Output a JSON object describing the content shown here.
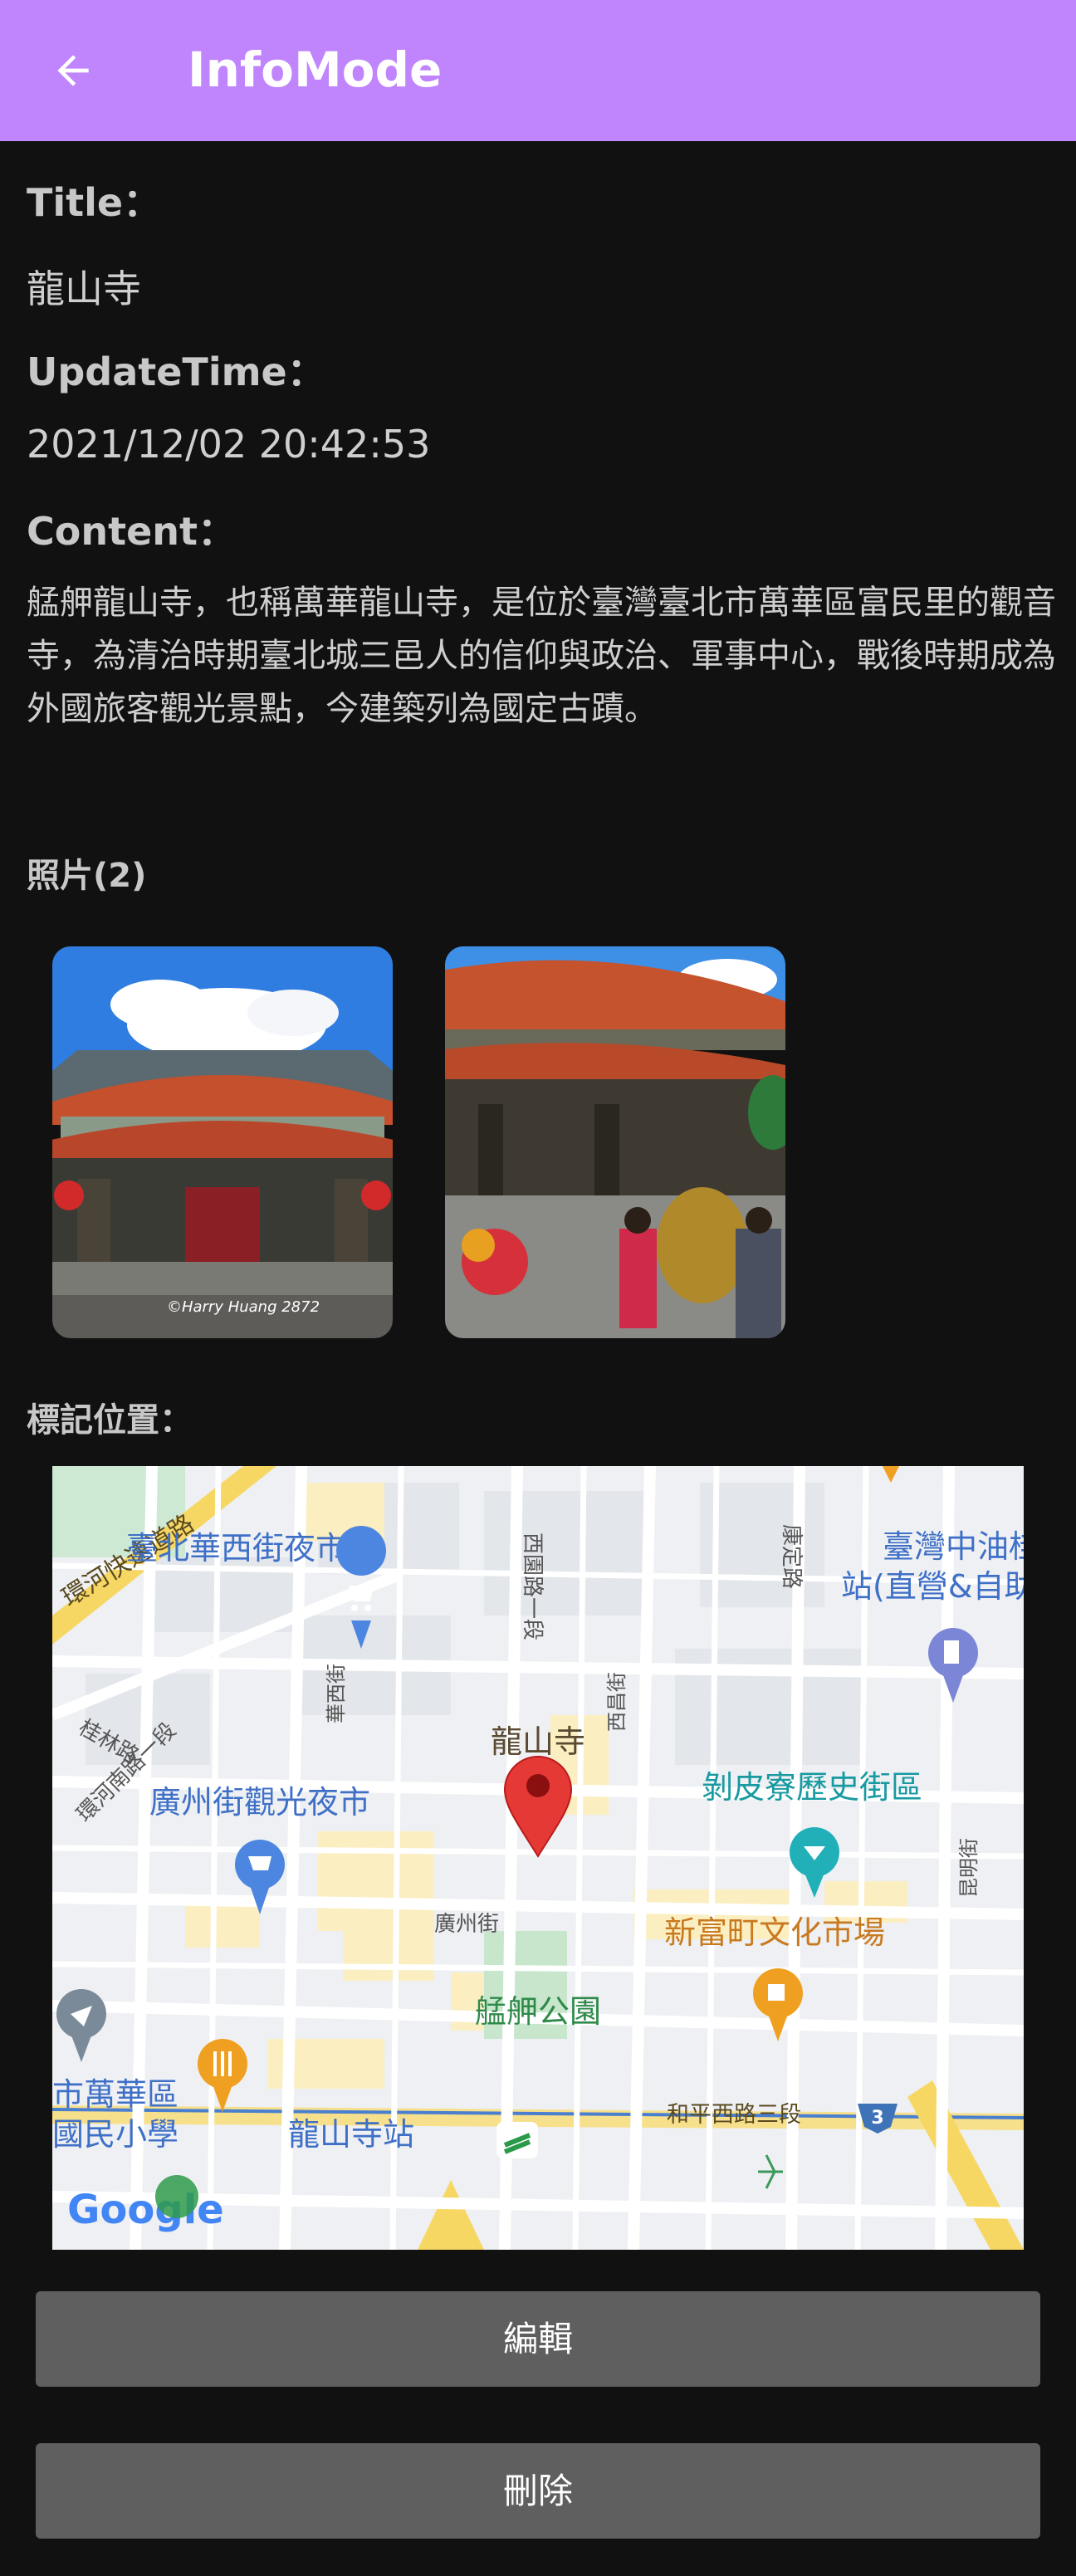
{
  "app_bar": {
    "title": "InfoMode",
    "back_icon": "arrow-left-icon",
    "color": "#c084fc"
  },
  "record": {
    "title_label": "Title：",
    "title_value": "龍山寺",
    "update_label": "UpdateTime：",
    "update_value": "2021/12/02 20:42:53",
    "content_label": "Content：",
    "content_value": "艋舺龍山寺，也稱萬華龍山寺，是位於臺灣臺北市萬華區富民里的觀音寺，為清治時期臺北城三邑人的信仰與政治、軍事中心，戰後時期成為外國旅客觀光景點，今建築列為國定古蹟。"
  },
  "photos": {
    "label": "照片(2)",
    "items": [
      {
        "caption": "©Harry Huang 2872"
      },
      {
        "caption": ""
      }
    ]
  },
  "map": {
    "label": "標記位置：",
    "marker_title": "龍山寺",
    "places": {
      "night_market_1": "臺北華西街夜市",
      "night_market_2": "廣州街觀光夜市",
      "gas_station_1": "臺灣中油桂林",
      "gas_station_2": "站(直營&自助",
      "historic_street": "剝皮寮歷史街區",
      "culture_market": "新富町文化市場",
      "park": "艋舺公園",
      "school_1": "市萬華區",
      "school_2": "國民小學",
      "mrt_station": "龍山寺站"
    },
    "roads": {
      "expressway": "環河快速道路",
      "guilin": "桂林路",
      "huanhe": "環河南路一段",
      "xiyuan": "西園路一段",
      "kangding": "康定路",
      "huaxi": "華西街",
      "xichang": "西昌街",
      "guangzhou": "廣州街",
      "heping": "和平西路三段",
      "kunming": "昆明街"
    },
    "route_badge": "3",
    "google_logo": "Google"
  },
  "buttons": {
    "edit": "編輯",
    "delete": "刪除"
  }
}
